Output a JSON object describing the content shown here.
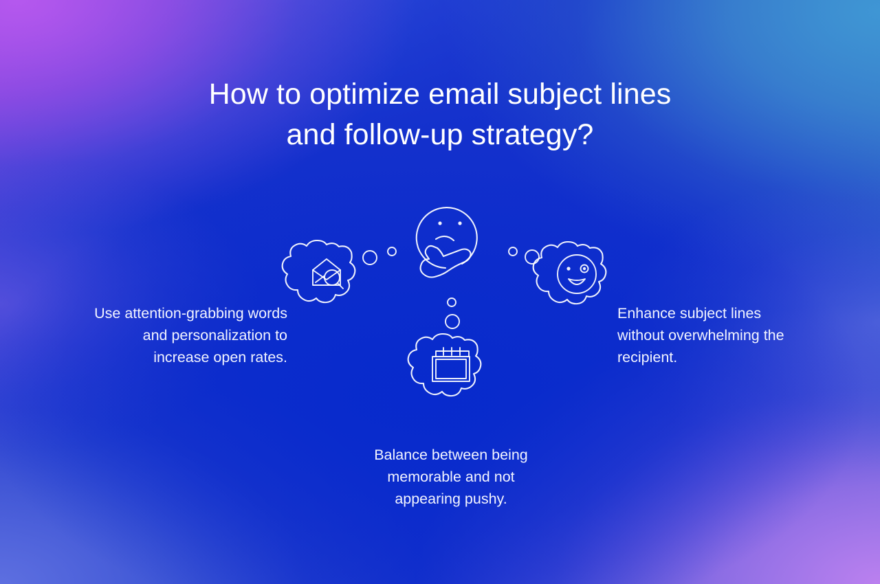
{
  "slide": {
    "title": "How to optimize email subject lines\nand follow-up strategy?",
    "background": {
      "center_color": "#1030cc",
      "top_left_color": "#a855e8",
      "top_right_color": "#3b8fd0",
      "bottom_left_color": "#4860d0",
      "bottom_right_color": "#b078e8"
    },
    "text_color": "#ffffff"
  },
  "nodes": [
    {
      "id": "attention-grabbing-words",
      "icon": "envelope-search-icon",
      "position": "left",
      "caption": "Use attention-grabbing words\nand personalization to\nincrease open rates."
    },
    {
      "id": "thinking",
      "icon": "thinking-face-icon",
      "position": "center-top",
      "caption": ""
    },
    {
      "id": "enhance-subject-lines",
      "icon": "winking-face-icon",
      "position": "right",
      "caption": "Enhance subject lines\nwithout overwhelming the\nrecipient."
    },
    {
      "id": "balance-memorable",
      "icon": "calendar-icon",
      "position": "center-bottom",
      "caption": "Balance between being\nmemorable and not\nappearing pushy."
    }
  ],
  "connectors": [
    {
      "id": "left-trail",
      "name": "thought-bubble-dots-left",
      "dots": 2
    },
    {
      "id": "right-trail",
      "name": "thought-bubble-dots-right",
      "dots": 2
    },
    {
      "id": "bottom-trail",
      "name": "thought-bubble-dots-bottom",
      "dots": 2
    }
  ]
}
